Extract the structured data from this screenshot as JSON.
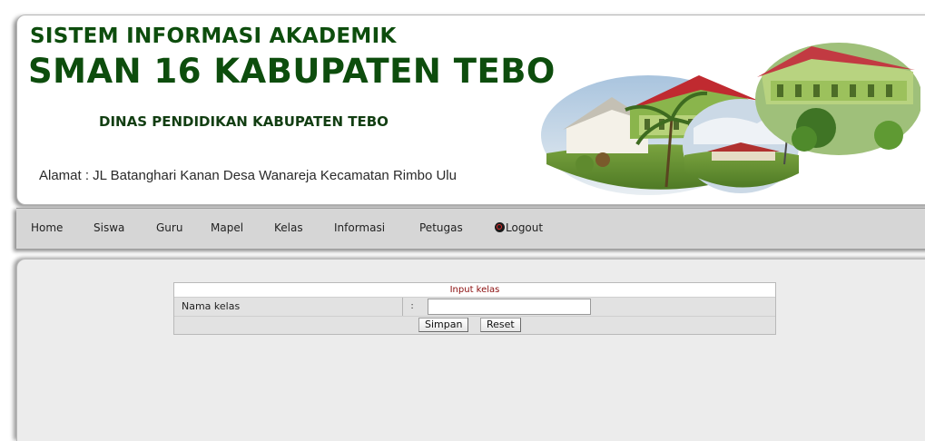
{
  "header": {
    "title_line1": "SISTEM INFORMASI AKADEMIK",
    "title_line2": "SMAN 16 KABUPATEN TEBO",
    "agency": "DINAS PENDIDIKAN KABUPATEN TEBO",
    "address": "Alamat : JL Batanghari Kanan Desa Wanareja Kecamatan Rimbo Ulu"
  },
  "nav": {
    "items": [
      "Home",
      "Siswa",
      "Guru",
      "Mapel",
      "Kelas",
      "Informasi",
      "Petugas"
    ],
    "logout_label": "Logout",
    "logout_icon": "power-icon"
  },
  "form": {
    "title": "Input kelas",
    "field_label": "Nama kelas",
    "colon": ":",
    "field_value": "",
    "submit_label": "Simpan",
    "reset_label": "Reset"
  },
  "colors": {
    "title_green": "#0d4d0d",
    "form_title_red": "#8a0d0d",
    "nav_bg": "#d6d6d6",
    "content_bg": "#ececec"
  }
}
